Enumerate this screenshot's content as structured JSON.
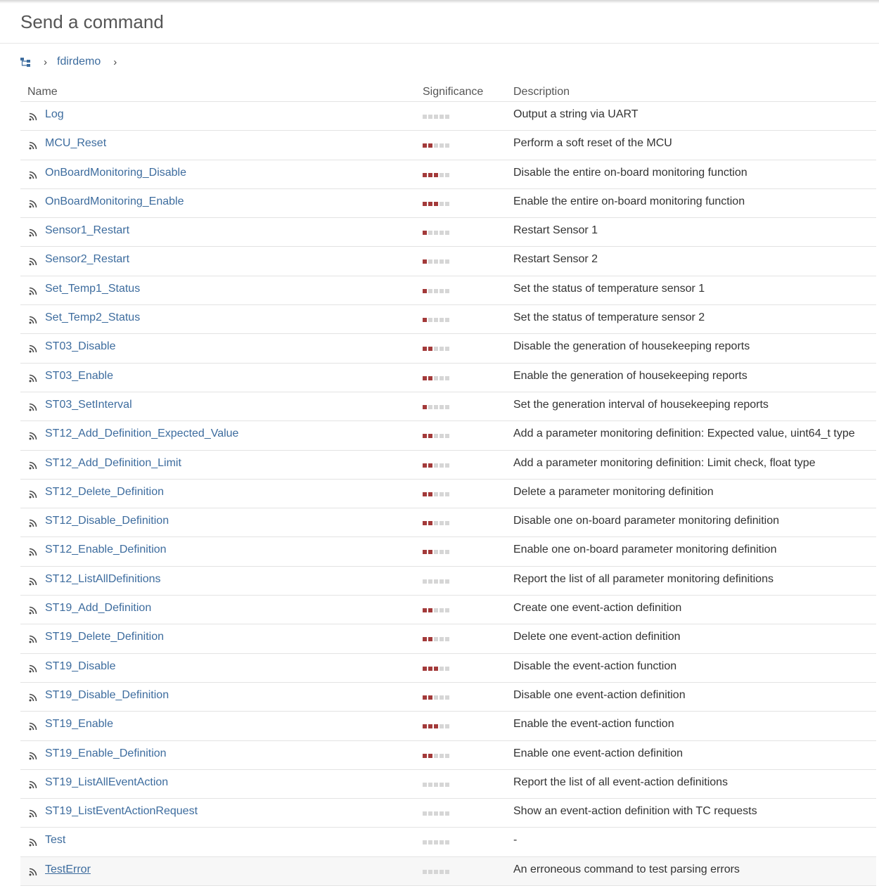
{
  "page": {
    "title": "Send a command"
  },
  "breadcrumb": {
    "home_icon": "tree-root-icon",
    "items": [
      "fdirdemo"
    ]
  },
  "table": {
    "columns": {
      "name": "Name",
      "significance": "Significance",
      "description": "Description"
    },
    "significance_colors": {
      "on": "#a33a3a",
      "off": "#d6d6d6"
    },
    "rows": [
      {
        "name": "Log",
        "significance": 0,
        "description": "Output a string via UART"
      },
      {
        "name": "MCU_Reset",
        "significance": 2,
        "description": "Perform a soft reset of the MCU"
      },
      {
        "name": "OnBoardMonitoring_Disable",
        "significance": 3,
        "description": "Disable the entire on-board monitoring function"
      },
      {
        "name": "OnBoardMonitoring_Enable",
        "significance": 3,
        "description": "Enable the entire on-board monitoring function"
      },
      {
        "name": "Sensor1_Restart",
        "significance": 1,
        "description": "Restart Sensor 1"
      },
      {
        "name": "Sensor2_Restart",
        "significance": 1,
        "description": "Restart Sensor 2"
      },
      {
        "name": "Set_Temp1_Status",
        "significance": 1,
        "description": "Set the status of temperature sensor 1"
      },
      {
        "name": "Set_Temp2_Status",
        "significance": 1,
        "description": "Set the status of temperature sensor 2"
      },
      {
        "name": "ST03_Disable",
        "significance": 2,
        "description": "Disable the generation of housekeeping reports"
      },
      {
        "name": "ST03_Enable",
        "significance": 2,
        "description": "Enable the generation of housekeeping reports"
      },
      {
        "name": "ST03_SetInterval",
        "significance": 1,
        "description": "Set the generation interval of housekeeping reports"
      },
      {
        "name": "ST12_Add_Definition_Expected_Value",
        "significance": 2,
        "description": "Add a parameter monitoring definition: Expected value, uint64_t type"
      },
      {
        "name": "ST12_Add_Definition_Limit",
        "significance": 2,
        "description": "Add a parameter monitoring definition: Limit check, float type"
      },
      {
        "name": "ST12_Delete_Definition",
        "significance": 2,
        "description": "Delete a parameter monitoring definition"
      },
      {
        "name": "ST12_Disable_Definition",
        "significance": 2,
        "description": "Disable one on-board parameter monitoring definition"
      },
      {
        "name": "ST12_Enable_Definition",
        "significance": 2,
        "description": "Enable one on-board parameter monitoring definition"
      },
      {
        "name": "ST12_ListAllDefinitions",
        "significance": 0,
        "description": "Report the list of all parameter monitoring definitions"
      },
      {
        "name": "ST19_Add_Definition",
        "significance": 2,
        "description": "Create one event-action definition"
      },
      {
        "name": "ST19_Delete_Definition",
        "significance": 2,
        "description": "Delete one event-action definition"
      },
      {
        "name": "ST19_Disable",
        "significance": 3,
        "description": "Disable the event-action function"
      },
      {
        "name": "ST19_Disable_Definition",
        "significance": 2,
        "description": "Disable one event-action definition"
      },
      {
        "name": "ST19_Enable",
        "significance": 3,
        "description": "Enable the event-action function"
      },
      {
        "name": "ST19_Enable_Definition",
        "significance": 2,
        "description": "Enable one event-action definition"
      },
      {
        "name": "ST19_ListAllEventAction",
        "significance": 0,
        "description": "Report the list of all event-action definitions"
      },
      {
        "name": "ST19_ListEventActionRequest",
        "significance": 0,
        "description": "Show an event-action definition with TC requests"
      },
      {
        "name": "Test",
        "significance": 0,
        "description": "-"
      },
      {
        "name": "TestError",
        "significance": 0,
        "description": "An erroneous command to test parsing errors",
        "hovered": true
      }
    ]
  }
}
